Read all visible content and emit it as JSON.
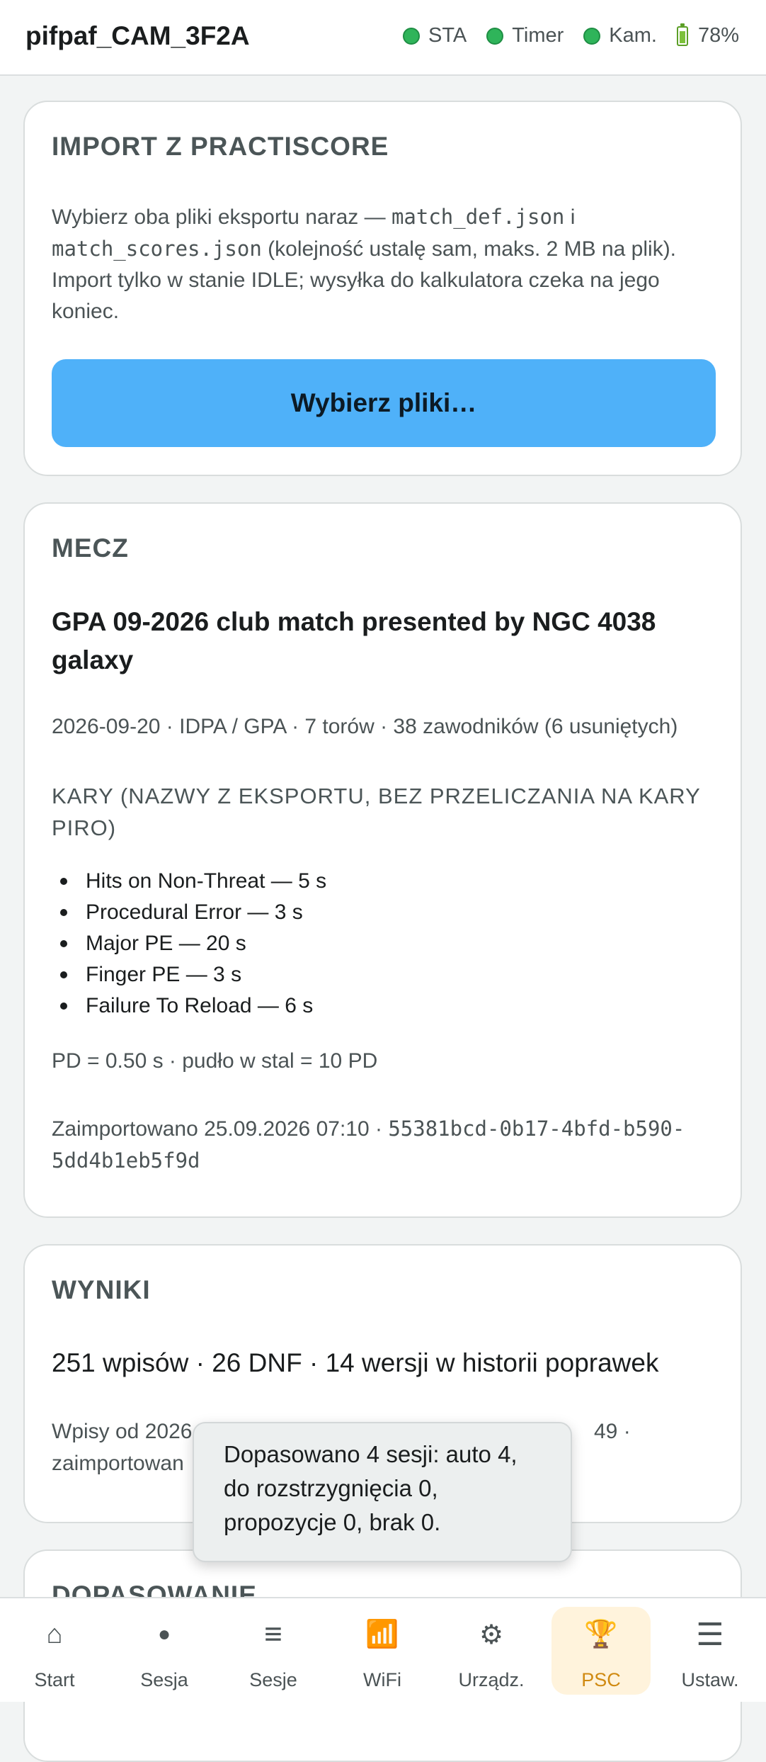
{
  "header": {
    "title": "pifpaf_CAM_3F2A",
    "indicators": [
      {
        "label": "STA",
        "state_color": "#2fb45a"
      },
      {
        "label": "Timer",
        "state_color": "#2fb45a"
      },
      {
        "label": "Kam.",
        "state_color": "#2fb45a"
      }
    ],
    "battery": "78%"
  },
  "import_card": {
    "heading": "IMPORT Z PRACTISCORE",
    "text_1": "Wybierz oba pliki eksportu naraz — ",
    "file_1": "match_def.json",
    "text_2": " i ",
    "file_2": "match_scores.json",
    "text_3": " (kolejność ustalę sam, maks. 2 MB na plik). Import tylko w stanie IDLE; wysyłka do kalkulatora czeka na jego koniec.",
    "button": "Wybierz pliki…"
  },
  "match_card": {
    "heading": "MECZ",
    "title": "GPA 09-2026 club match presented by NGC 4038 galaxy",
    "meta": "2026-09-20 · IDPA / GPA · 7 torów · 38 zawodników (6 usuniętych)",
    "penalties_heading": "KARY (NAZWY Z EKSPORTU, BEZ PRZELICZANIA NA KARY PIRO)",
    "penalties": [
      "Hits on Non-Threat — 5 s",
      "Procedural Error — 3 s",
      "Major PE — 20 s",
      "Finger PE — 3 s",
      "Failure To Reload — 6 s"
    ],
    "pd": "PD = 0.50 s · pudło w stal = 10 PD",
    "imported_prefix": "Zaimportowano 25.09.2026 07:10 · ",
    "imported_id": "55381bcd-0b17-4bfd-b590-5dd4b1eb5f9d"
  },
  "results_card": {
    "heading": "WYNIKI",
    "summary": "251 wpisów · 26 DNF · 14 wersji w historii poprawek",
    "sub_left_1": "Wpisy od 2026",
    "sub_right_1": "49 ·",
    "sub_left_2": "zaimportowan"
  },
  "next_card": {
    "heading": "DOPASOWANIE"
  },
  "toast": {
    "line_1": "Dopasowano 4 sesji: auto 4,",
    "line_2": "do rozstrzygnięcia 0,",
    "line_3": "propozycje 0, brak 0."
  },
  "nav": [
    {
      "icon": "home-icon",
      "glyph": "⌂",
      "label": "Start"
    },
    {
      "icon": "record-dot-icon",
      "glyph": "●",
      "label": "Sesja"
    },
    {
      "icon": "list-icon",
      "glyph": "≡",
      "label": "Sesje"
    },
    {
      "icon": "wifi-icon",
      "glyph": "📶",
      "label": "WiFi"
    },
    {
      "icon": "gear-icon",
      "glyph": "⚙",
      "label": "Urządz."
    },
    {
      "icon": "trophy-icon",
      "glyph": "🏆",
      "label": "PSC",
      "active": true
    },
    {
      "icon": "menu-icon",
      "glyph": "☰",
      "label": "Ustaw."
    }
  ],
  "colors": {
    "accent_button": "#4fb1f9",
    "active_nav_bg": "#fff3dc",
    "active_nav_text": "#d08a12",
    "status_ok": "#2fb45a"
  }
}
